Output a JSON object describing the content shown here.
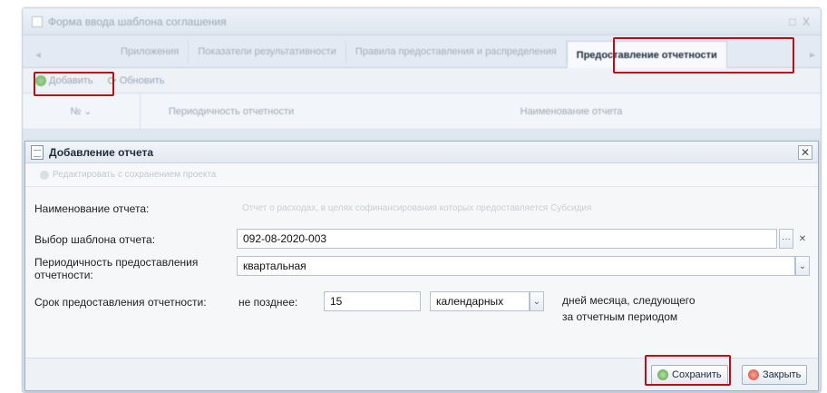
{
  "background": {
    "window_title": "Форма ввода шаблона соглашения",
    "window_controls": "□ X",
    "tab_left_arrow": "◂",
    "tab_right_arrow": "▸",
    "tabs": [
      {
        "label": "Приложения"
      },
      {
        "label": "Показатели результативности"
      },
      {
        "label": "Правила предоставления и распределения"
      },
      {
        "label": "Предоставление отчетности"
      }
    ],
    "toolbar": {
      "add_label": "Добавить",
      "refresh_label": "Обновить"
    },
    "grid": {
      "col_num": "№ ⌄",
      "col_period": "Периодичность отчетности",
      "col_name": "Наименование отчета"
    }
  },
  "dialog": {
    "title": "Добавление отчета",
    "close_glyph": "✕",
    "subtoolbar_text": "Редактировать с сохранением проекта",
    "fields": {
      "report_name_label": "Наименование отчета:",
      "report_name_value": "Отчет о расходах, в целях софинансирования которых предоставляется Субсидия",
      "template_label": "Выбор шаблона отчета:",
      "template_value": "092-08-2020-003",
      "template_browse": "···",
      "template_clear": "✕",
      "period_label": "Периодичность предоставления отчетности:",
      "period_value": "квартальная",
      "deadline_label": "Срок предоставления отчетности:",
      "deadline_prefix": "не позднее:",
      "deadline_days": "15",
      "deadline_type": "календарных",
      "deadline_suffix_line1": "дней месяца, следующего",
      "deadline_suffix_line2": "за отчетным периодом",
      "dropdown_glyph": "⌄"
    },
    "buttons": {
      "save_label": "Сохранить",
      "close_label": "Закрыть"
    }
  },
  "colors": {
    "highlight": "#b3111a",
    "accent_green": "#4fa043",
    "accent_red": "#d64533"
  }
}
